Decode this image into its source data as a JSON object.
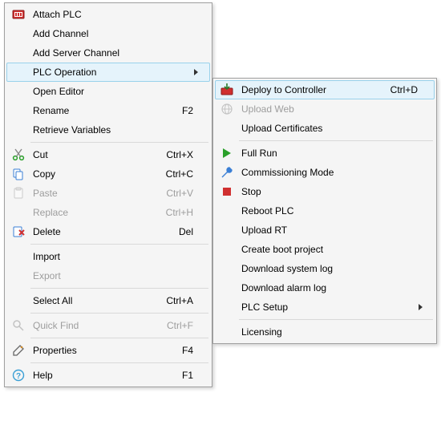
{
  "menu_left": {
    "items": [
      {
        "label": "Attach PLC"
      },
      {
        "label": "Add Channel"
      },
      {
        "label": "Add Server Channel"
      },
      {
        "label": "PLC Operation"
      },
      {
        "label": "Open Editor"
      },
      {
        "label": "Rename",
        "shortcut": "F2"
      },
      {
        "label": "Retrieve Variables"
      },
      {
        "label": "Cut",
        "shortcut": "Ctrl+X"
      },
      {
        "label": "Copy",
        "shortcut": "Ctrl+C"
      },
      {
        "label": "Paste",
        "shortcut": "Ctrl+V"
      },
      {
        "label": "Replace",
        "shortcut": "Ctrl+H"
      },
      {
        "label": "Delete",
        "shortcut": "Del"
      },
      {
        "label": "Import"
      },
      {
        "label": "Export"
      },
      {
        "label": "Select All",
        "shortcut": "Ctrl+A"
      },
      {
        "label": "Quick Find",
        "shortcut": "Ctrl+F"
      },
      {
        "label": "Properties",
        "shortcut": "F4"
      },
      {
        "label": "Help",
        "shortcut": "F1"
      }
    ]
  },
  "menu_right": {
    "items": [
      {
        "label": "Deploy to Controller",
        "shortcut": "Ctrl+D"
      },
      {
        "label": "Upload Web"
      },
      {
        "label": "Upload Certificates"
      },
      {
        "label": "Full Run"
      },
      {
        "label": "Commissioning Mode"
      },
      {
        "label": "Stop"
      },
      {
        "label": "Reboot PLC"
      },
      {
        "label": "Upload RT"
      },
      {
        "label": "Create boot project"
      },
      {
        "label": "Download system log"
      },
      {
        "label": "Download alarm log"
      },
      {
        "label": "PLC Setup"
      },
      {
        "label": "Licensing"
      }
    ]
  }
}
